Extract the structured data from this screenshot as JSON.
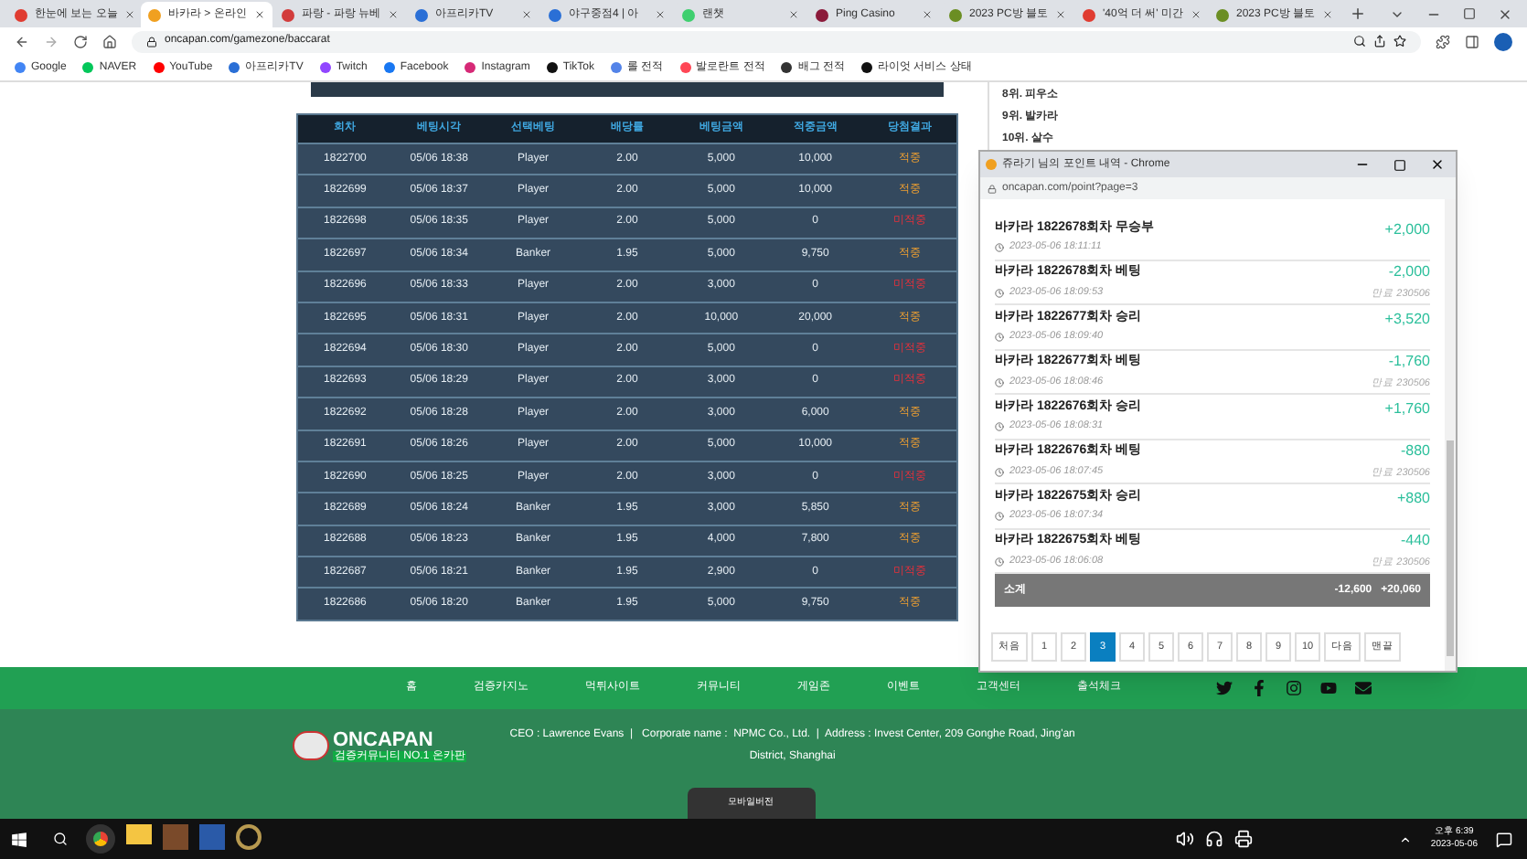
{
  "browser": {
    "tabs": [
      {
        "title": "한눈에 보는 오늘",
        "color": "#e03c31",
        "selected": false
      },
      {
        "title": "바카라 > 온라인 ",
        "color": "#f0a020",
        "selected": true
      },
      {
        "title": "파랑 - 파랑 뉴베",
        "color": "#d23c3c",
        "selected": false
      },
      {
        "title": "아프리카TV",
        "color": "#2a6fd6",
        "selected": false
      },
      {
        "title": "야구중점4 | 아",
        "color": "#2a6fd6",
        "selected": false
      },
      {
        "title": "랜챗",
        "color": "#3fcf6f",
        "selected": false
      },
      {
        "title": "Ping Casino",
        "color": "#8b1a3a",
        "selected": false
      },
      {
        "title": "2023 PC방 블토",
        "color": "#6b8e23",
        "selected": false
      },
      {
        "title": "'40억 더 써' 미간",
        "color": "#e03c31",
        "selected": false
      },
      {
        "title": "2023 PC방 블토",
        "color": "#6b8e23",
        "selected": false
      }
    ],
    "url": "oncapan.com/gamezone/baccarat",
    "bookmarks": [
      {
        "label": "Google",
        "color": "#4285f4"
      },
      {
        "label": "NAVER",
        "color": "#03c75a"
      },
      {
        "label": "YouTube",
        "color": "#ff0000"
      },
      {
        "label": "아프리카TV",
        "color": "#2a6fd6"
      },
      {
        "label": "Twitch",
        "color": "#9146ff"
      },
      {
        "label": "Facebook",
        "color": "#1877f2"
      },
      {
        "label": "Instagram",
        "color": "#d62976"
      },
      {
        "label": "TikTok",
        "color": "#111111"
      },
      {
        "label": "롤 전적",
        "color": "#5383e8"
      },
      {
        "label": "발로란트 전적",
        "color": "#ff4655"
      },
      {
        "label": "배그 전적",
        "color": "#333333"
      },
      {
        "label": "라이엇 서비스 상태",
        "color": "#111111"
      }
    ]
  },
  "bet_table": {
    "columns": [
      "회차",
      "베팅시각",
      "선택베팅",
      "배당률",
      "베팅금액",
      "적중금액",
      "당첨결과"
    ],
    "rows": [
      {
        "cells": [
          "1822700",
          "05/06 18:38",
          "Player",
          "2.00",
          "5,000",
          "10,000"
        ],
        "result": "적중",
        "won": true
      },
      {
        "cells": [
          "1822699",
          "05/06 18:37",
          "Player",
          "2.00",
          "5,000",
          "10,000"
        ],
        "result": "적중",
        "won": true
      },
      {
        "cells": [
          "1822698",
          "05/06 18:35",
          "Player",
          "2.00",
          "5,000",
          "0"
        ],
        "result": "미적중",
        "won": false
      },
      {
        "cells": [
          "1822697",
          "05/06 18:34",
          "Banker",
          "1.95",
          "5,000",
          "9,750"
        ],
        "result": "적중",
        "won": true
      },
      {
        "cells": [
          "1822696",
          "05/06 18:33",
          "Player",
          "2.00",
          "3,000",
          "0"
        ],
        "result": "미적중",
        "won": false
      },
      {
        "cells": [
          "1822695",
          "05/06 18:31",
          "Player",
          "2.00",
          "10,000",
          "20,000"
        ],
        "result": "적중",
        "won": true
      },
      {
        "cells": [
          "1822694",
          "05/06 18:30",
          "Player",
          "2.00",
          "5,000",
          "0"
        ],
        "result": "미적중",
        "won": false
      },
      {
        "cells": [
          "1822693",
          "05/06 18:29",
          "Player",
          "2.00",
          "3,000",
          "0"
        ],
        "result": "미적중",
        "won": false
      },
      {
        "cells": [
          "1822692",
          "05/06 18:28",
          "Player",
          "2.00",
          "3,000",
          "6,000"
        ],
        "result": "적중",
        "won": true
      },
      {
        "cells": [
          "1822691",
          "05/06 18:26",
          "Player",
          "2.00",
          "5,000",
          "10,000"
        ],
        "result": "적중",
        "won": true
      },
      {
        "cells": [
          "1822690",
          "05/06 18:25",
          "Player",
          "2.00",
          "3,000",
          "0"
        ],
        "result": "미적중",
        "won": false
      },
      {
        "cells": [
          "1822689",
          "05/06 18:24",
          "Banker",
          "1.95",
          "3,000",
          "5,850"
        ],
        "result": "적중",
        "won": true
      },
      {
        "cells": [
          "1822688",
          "05/06 18:23",
          "Banker",
          "1.95",
          "4,000",
          "7,800"
        ],
        "result": "적중",
        "won": true
      },
      {
        "cells": [
          "1822687",
          "05/06 18:21",
          "Banker",
          "1.95",
          "2,900",
          "0"
        ],
        "result": "미적중",
        "won": false
      },
      {
        "cells": [
          "1822686",
          "05/06 18:20",
          "Banker",
          "1.95",
          "5,000",
          "9,750"
        ],
        "result": "적중",
        "won": true
      }
    ]
  },
  "ranking": [
    "8위. 피우소",
    "9위. 발카라",
    "10위. 살수"
  ],
  "popup": {
    "title": "쥬라기 님의 포인트 내역 - Chrome",
    "url": "oncapan.com/point?page=3",
    "entries": [
      {
        "title": "바카라 1822678회차 무승부",
        "time": "2023-05-06 18:11:11",
        "amount": "+2,000"
      },
      {
        "title": "바카라 1822678회차 베팅",
        "time": "2023-05-06 18:09:53",
        "amount": "-2,000",
        "expiry": "만료 230506"
      },
      {
        "title": "바카라 1822677회차 승리",
        "time": "2023-05-06 18:09:40",
        "amount": "+3,520"
      },
      {
        "title": "바카라 1822677회차 베팅",
        "time": "2023-05-06 18:08:46",
        "amount": "-1,760",
        "expiry": "만료 230506"
      },
      {
        "title": "바카라 1822676회차 승리",
        "time": "2023-05-06 18:08:31",
        "amount": "+1,760"
      },
      {
        "title": "바카라 1822676회차 베팅",
        "time": "2023-05-06 18:07:45",
        "amount": "-880",
        "expiry": "만료 230506"
      },
      {
        "title": "바카라 1822675회차 승리",
        "time": "2023-05-06 18:07:34",
        "amount": "+880"
      },
      {
        "title": "바카라 1822675회차 베팅",
        "time": "2023-05-06 18:06:08",
        "amount": "-440",
        "expiry": "만료 230506"
      }
    ],
    "subtotal": {
      "label": "소계",
      "minus": "-12,600",
      "plus": "+20,060"
    },
    "pages": [
      {
        "label": "처음",
        "selected": false
      },
      {
        "label": "1",
        "selected": false
      },
      {
        "label": "2",
        "selected": false
      },
      {
        "label": "3",
        "selected": true
      },
      {
        "label": "4",
        "selected": false
      },
      {
        "label": "5",
        "selected": false
      },
      {
        "label": "6",
        "selected": false
      },
      {
        "label": "7",
        "selected": false
      },
      {
        "label": "8",
        "selected": false
      },
      {
        "label": "9",
        "selected": false
      },
      {
        "label": "10",
        "selected": false
      },
      {
        "label": "다음",
        "selected": false
      },
      {
        "label": "맨끝",
        "selected": false
      }
    ]
  },
  "nav": [
    "홈",
    "검증카지노",
    "먹튀사이트",
    "커뮤니티",
    "게임존",
    "이벤트",
    "고객센터",
    "출석체크"
  ],
  "footer": {
    "logo": "ONCAPAN",
    "logo_sub": "검증커뮤니티 NO.1 온카판",
    "info": "CEO : Lawrence Evans  |   Corporate name :  NPMC Co., Ltd.  |  Address : Invest Center, 209 Gonghe Road, Jing'an District, Shanghai",
    "mobile_button": "모바일버전"
  },
  "taskbar": {
    "time": "오후 6:39",
    "date": "2023-05-06"
  }
}
